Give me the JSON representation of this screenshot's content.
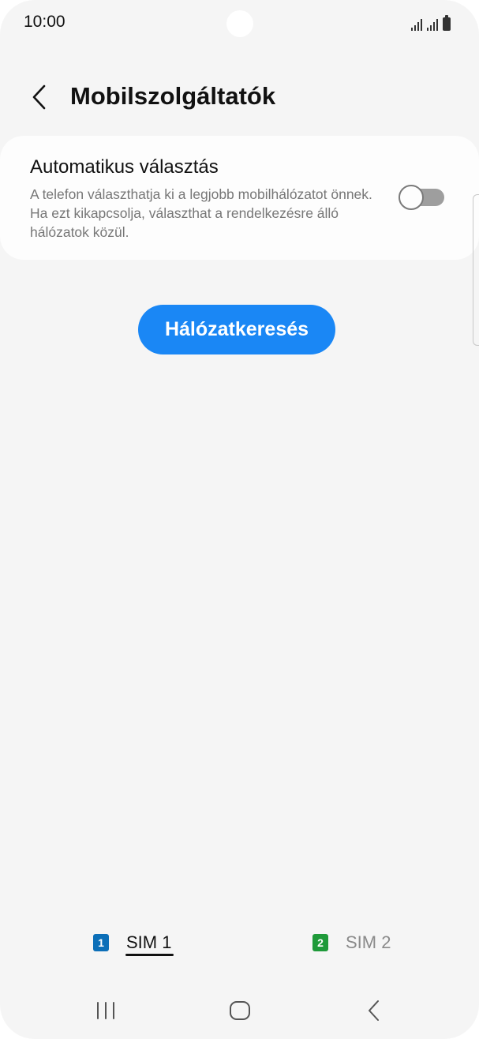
{
  "status_bar": {
    "time": "10:00"
  },
  "header": {
    "title": "Mobilszolgáltatók",
    "back_icon": "chevron-left-icon"
  },
  "auto_select": {
    "title": "Automatikus választás",
    "description": "A telefon választhatja ki a legjobb mobilhálózatot önnek. Ha ezt kikapcsolja, választhat a rendelkezésre álló hálózatok közül.",
    "toggle_on": false
  },
  "search_button": {
    "label": "Hálózatkeresés",
    "color": "#1a87f5"
  },
  "sim_tabs": [
    {
      "badge": "1",
      "label": "SIM 1",
      "selected": true,
      "color": "#0c6fb8"
    },
    {
      "badge": "2",
      "label": "SIM 2",
      "selected": false,
      "color": "#1f9a3a"
    }
  ],
  "nav_bar": {
    "recents_icon": "recents-icon",
    "home_icon": "home-icon",
    "back_icon": "back-icon"
  }
}
